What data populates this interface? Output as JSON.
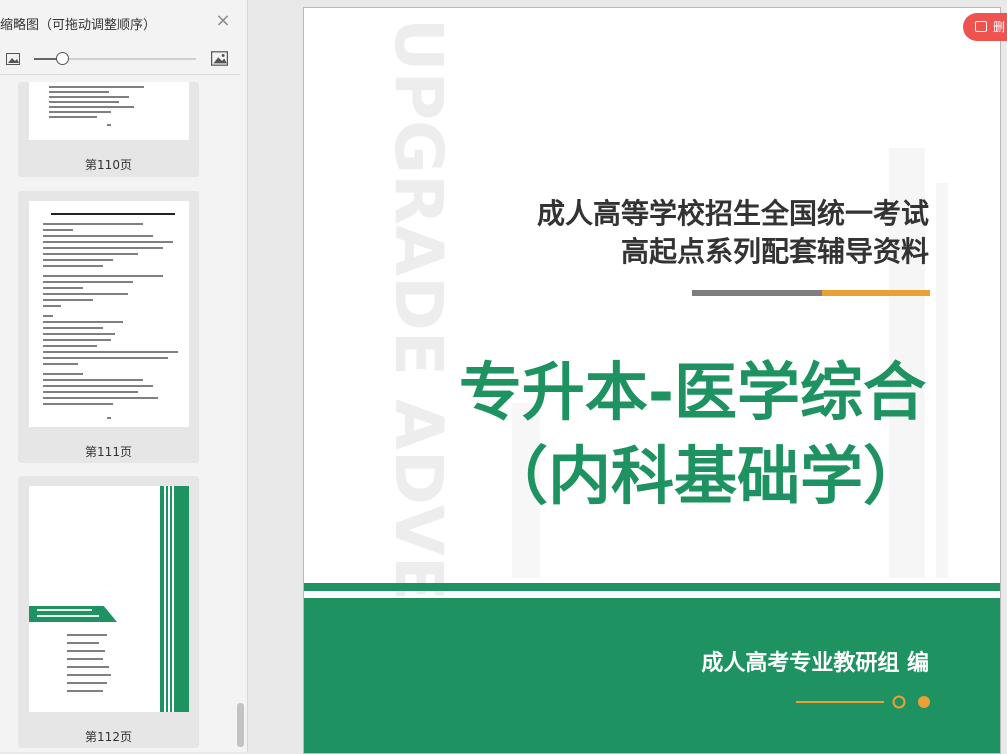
{
  "sidebar": {
    "title": "缩略图（可拖动调整顺序）",
    "close_icon": "×",
    "pages": [
      {
        "label": "第110页"
      },
      {
        "label": "第111页"
      },
      {
        "label": "第112页"
      }
    ]
  },
  "cover": {
    "vertical_watermark": "UPGRADE ADVERSE",
    "heading_line1": "成人高等学校招生全国统一考试",
    "heading_line2": "高起点系列配套辅导资料",
    "main_title_line1": "专升本-医学综合",
    "main_title_line2": "（内科基础学）",
    "author": "成人高考专业教研组 编"
  },
  "badge": {
    "label": "删"
  },
  "colors": {
    "green": "#1e9261",
    "orange": "#eaa035",
    "gray_bar": "#7d7d7d"
  }
}
